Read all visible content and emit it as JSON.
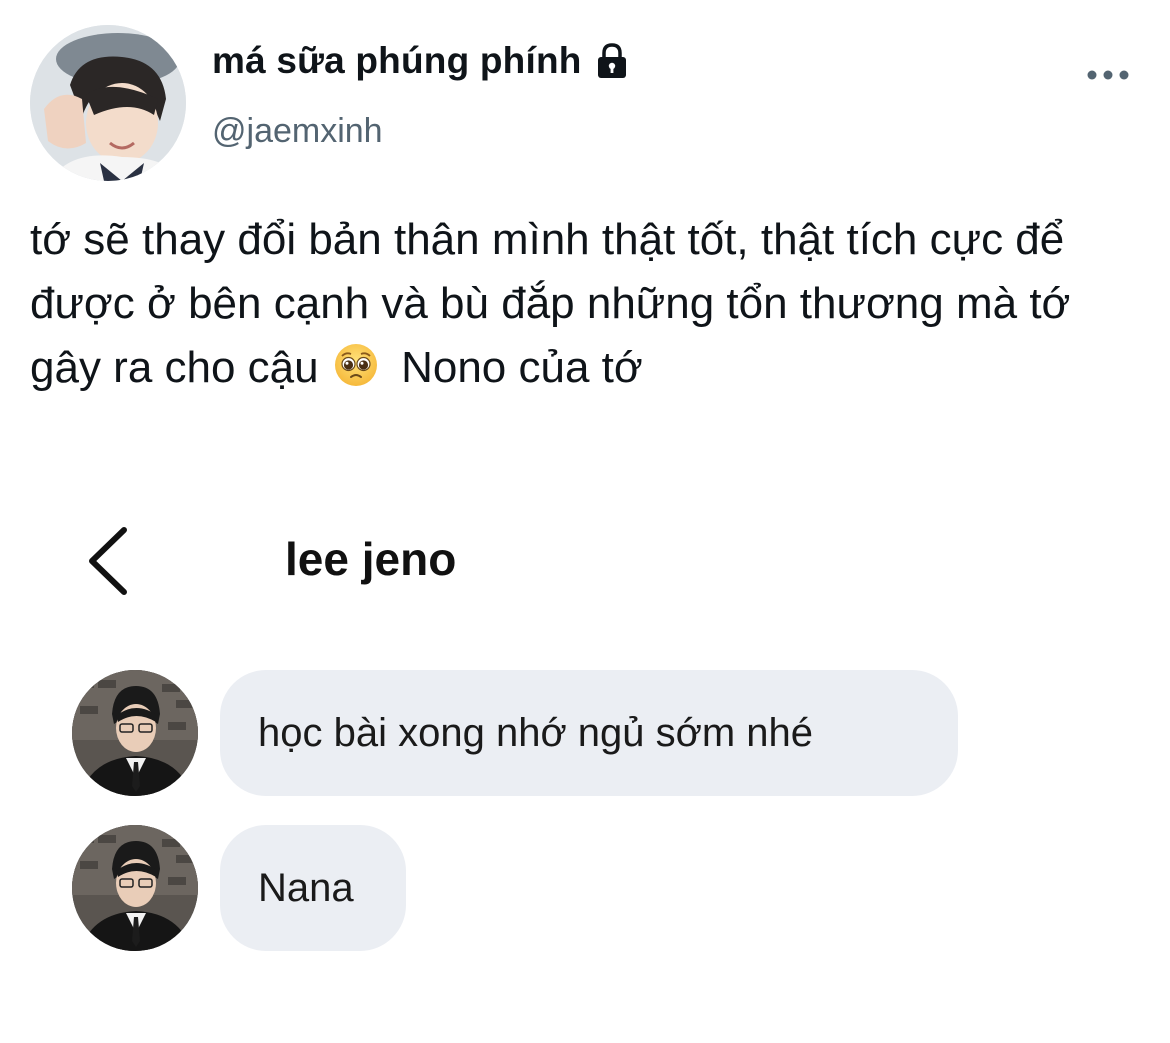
{
  "tweet": {
    "author": {
      "display_name": "má sữa phúng phính",
      "handle": "@jaemxinh",
      "protected_icon": "lock-icon",
      "avatar": "profile-photo"
    },
    "more_icon": "more-horizontal-icon",
    "text_before_emoji": "tớ sẽ thay đổi bản thân mình thật tốt, thật tích cực để được ở bên cạnh và bù đắp những tổn thương mà tớ gây ra cho cậu",
    "emoji": "pleading-face-emoji",
    "text_after_emoji": "Nono của tớ"
  },
  "dm_screenshot": {
    "back_icon": "chevron-left-icon",
    "contact_name": "lee jeno",
    "messages": [
      {
        "sender_avatar": "contact-photo",
        "text": "học bài xong nhớ ngủ sớm nhé"
      },
      {
        "sender_avatar": "contact-photo",
        "text": "Nana"
      }
    ]
  },
  "colors": {
    "text_primary": "#0f1419",
    "text_secondary": "#536471",
    "bubble_background": "#ebeef3",
    "background": "#ffffff"
  }
}
